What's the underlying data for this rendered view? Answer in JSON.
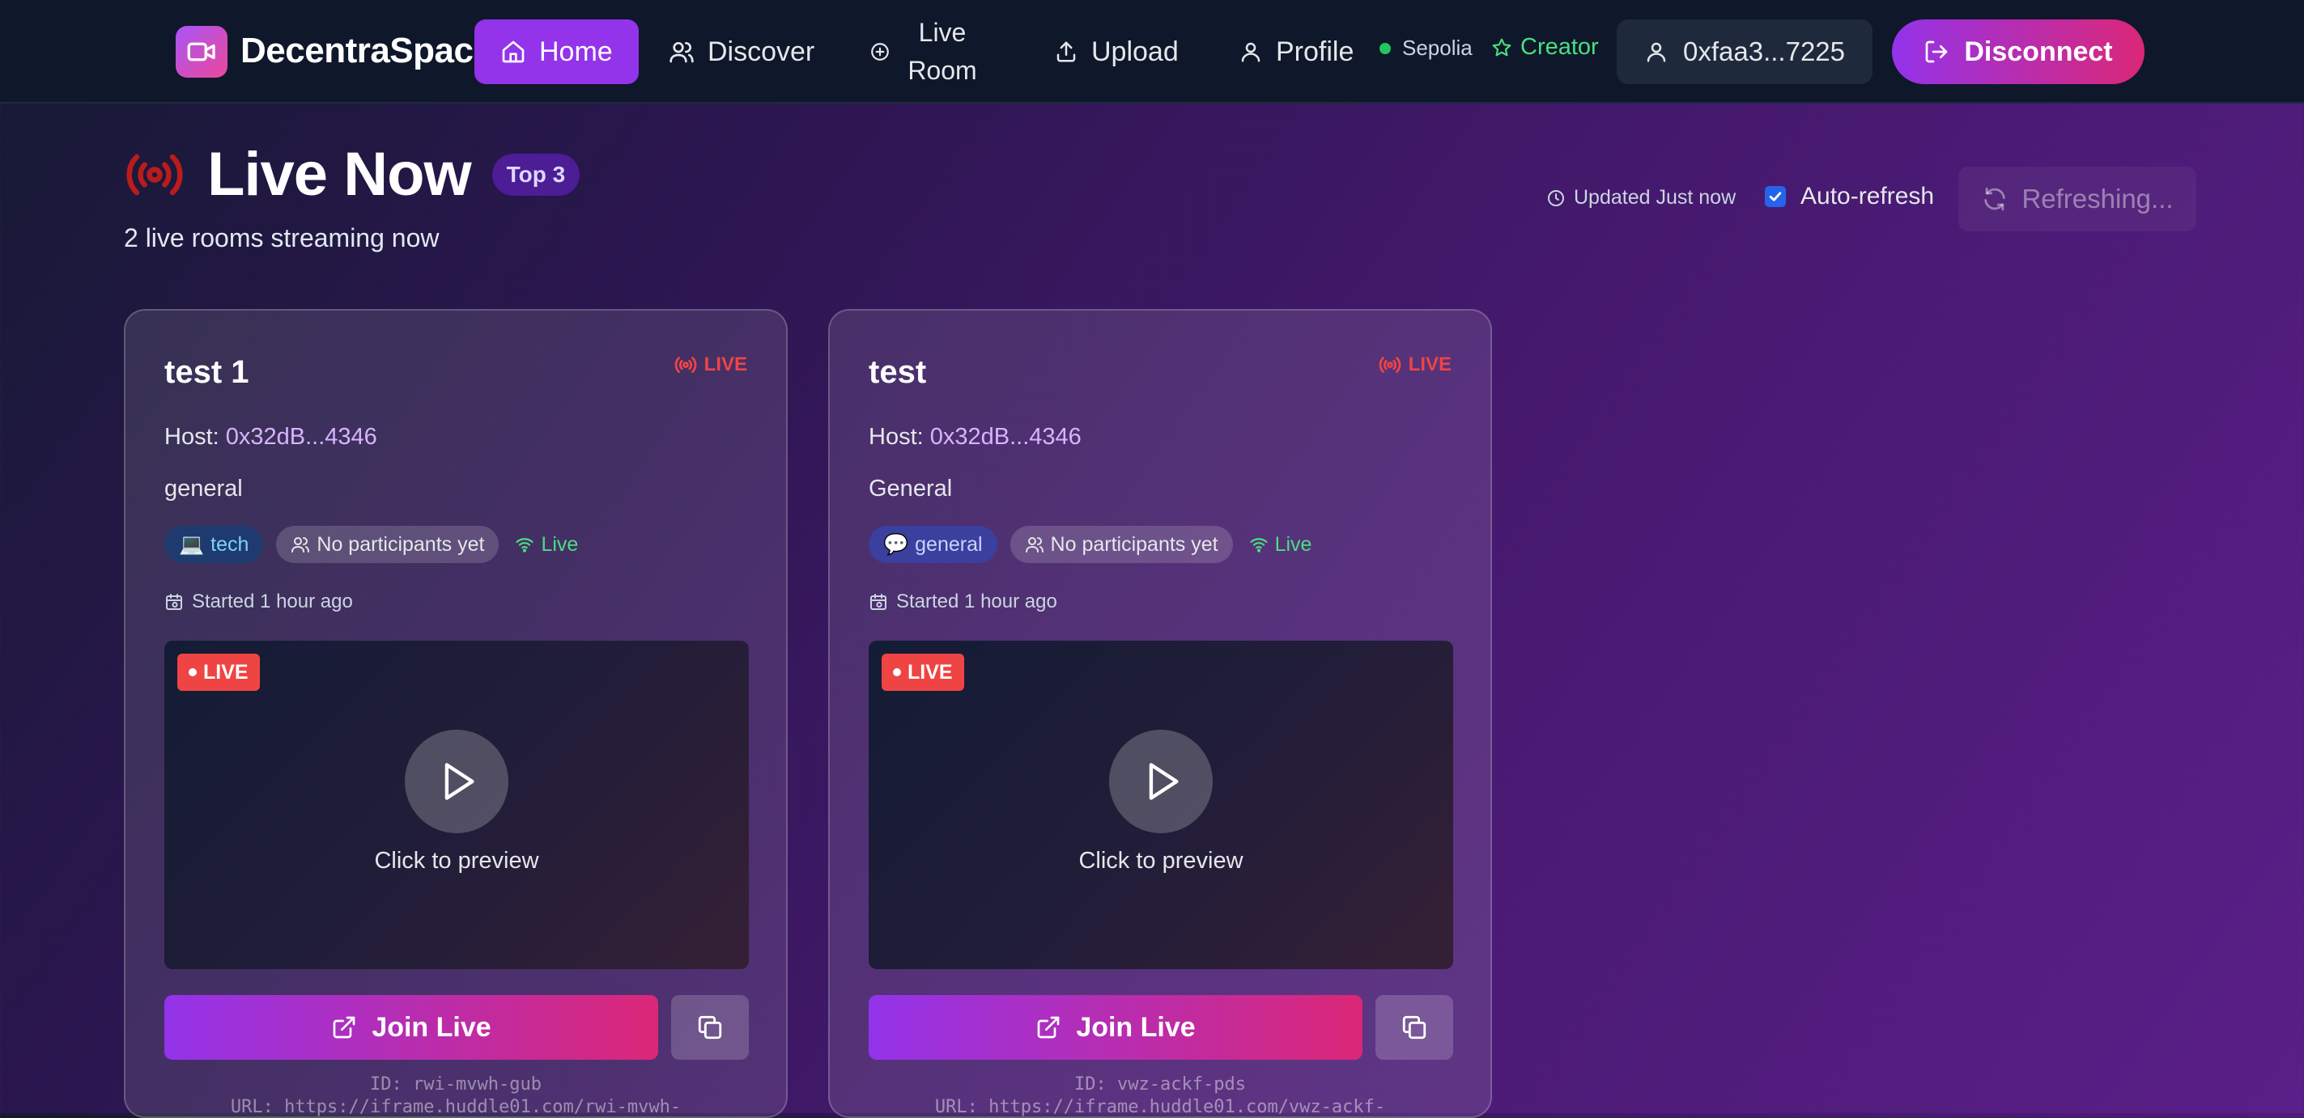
{
  "nav": {
    "brand": "DecentraSpace",
    "items": [
      {
        "label": "Home",
        "icon": "home-icon",
        "active": true
      },
      {
        "label": "Discover",
        "icon": "users-icon"
      },
      {
        "label": "Live Room",
        "icon": "plus-circle-icon"
      },
      {
        "label": "Upload",
        "icon": "upload-icon"
      },
      {
        "label": "Profile",
        "icon": "user-icon"
      }
    ],
    "network": "Sepolia",
    "role": "Creator",
    "wallet": "0xfaa3...7225",
    "disconnect": "Disconnect"
  },
  "header": {
    "title": "Live Now",
    "badge": "Top 3",
    "subtitle": "2 live rooms streaming now",
    "updated": "Updated Just now",
    "auto_refresh_label": "Auto-refresh",
    "auto_refresh_checked": true,
    "refresh_button": "Refreshing..."
  },
  "rooms": [
    {
      "title": "test 1",
      "live_label": "LIVE",
      "host_label": "Host:",
      "host": "0x32dB...4346",
      "description": "general",
      "category": "tech",
      "category_emoji": "💻",
      "participants": "No participants yet",
      "status": "Live",
      "started": "Started 1 hour ago",
      "preview_badge": "LIVE",
      "preview_text": "Click to preview",
      "join": "Join Live",
      "id_line": "ID: rwi-mvwh-gub",
      "url_line": "URL: https://iframe.huddle01.com/rwi-mvwh-"
    },
    {
      "title": "test",
      "live_label": "LIVE",
      "host_label": "Host:",
      "host": "0x32dB...4346",
      "description": "General",
      "category": "general",
      "category_emoji": "💬",
      "participants": "No participants yet",
      "status": "Live",
      "started": "Started 1 hour ago",
      "preview_badge": "LIVE",
      "preview_text": "Click to preview",
      "join": "Join Live",
      "id_line": "ID: vwz-ackf-pds",
      "url_line": "URL: https://iframe.huddle01.com/vwz-ackf-"
    }
  ],
  "colors": {
    "accent": "#9333ea",
    "accent_pink": "#db2777",
    "live_red": "#ef4444",
    "success_green": "#4ade80",
    "nav_bg": "#0f172a"
  }
}
